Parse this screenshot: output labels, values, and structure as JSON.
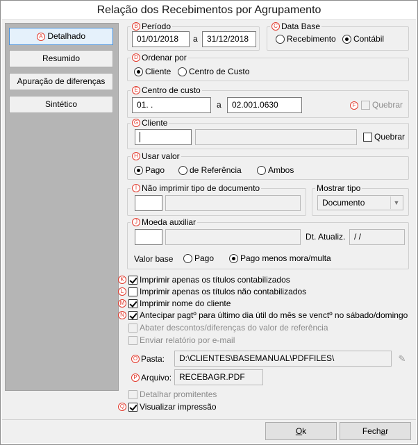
{
  "window": {
    "title": "Relação dos Recebimentos por Agrupamento"
  },
  "nav": {
    "items": [
      {
        "label": "Detalhado",
        "marker": "A"
      },
      {
        "label": "Resumido"
      },
      {
        "label": "Apuração de diferenças"
      },
      {
        "label": "Sintético"
      }
    ]
  },
  "periodo": {
    "legend": "Período",
    "marker": "B",
    "from": "01/01/2018",
    "sep": "a",
    "to": "31/12/2018"
  },
  "data_base": {
    "legend": "Data Base",
    "marker": "C",
    "opt1": "Recebimento",
    "opt2": "Contábil",
    "selected": "Contábil"
  },
  "ordenar": {
    "legend": "Ordenar por",
    "marker": "D",
    "opt1": "Cliente",
    "opt2": "Centro de Custo",
    "selected": "Cliente"
  },
  "centro": {
    "legend": "Centro de custo",
    "marker": "E",
    "from": "01.   .",
    "sep": "a",
    "to": "02.001.0630",
    "quebrar_marker": "F",
    "quebrar": "Quebrar"
  },
  "cliente": {
    "legend": "Cliente",
    "marker": "G",
    "code": "",
    "name": "",
    "quebrar": "Quebrar"
  },
  "usar_valor": {
    "legend": "Usar valor",
    "marker": "H",
    "opt1": "Pago",
    "opt2": "de Referência",
    "opt3": "Ambos",
    "selected": "Pago"
  },
  "nao_imprimir": {
    "legend": "Não imprimir tipo de documento",
    "marker": "I",
    "code": "",
    "desc": ""
  },
  "mostrar_tipo": {
    "legend": "Mostrar tipo",
    "value": "Documento"
  },
  "moeda": {
    "legend": "Moeda auxiliar",
    "marker": "J",
    "code": "",
    "desc": "",
    "dt_label": "Dt. Atualiz.",
    "dt_value": "/ /",
    "valor_base_label": "Valor base",
    "vb_opt1": "Pago",
    "vb_opt2": "Pago menos mora/multa",
    "vb_selected": "Pago menos mora/multa"
  },
  "checks": {
    "k": {
      "marker": "K",
      "label": "Imprimir apenas os títulos contabilizados",
      "checked": true
    },
    "l": {
      "marker": "L",
      "label": "Imprimir apenas os títulos não contabilizados",
      "checked": false
    },
    "m": {
      "marker": "M",
      "label": "Imprimir nome do cliente",
      "checked": true
    },
    "n": {
      "marker": "N",
      "label": "Antecipar pagtº para último dia útil do mês se venctº no sábado/domingo",
      "checked": true
    },
    "abater": {
      "label": "Abater descontos/diferenças do valor de referência",
      "checked": false
    },
    "email": {
      "label": "Enviar relatório por e-mail",
      "checked": false
    },
    "detalhar": {
      "label": "Detalhar promitentes",
      "checked": false
    },
    "q": {
      "marker": "Q",
      "label": "Visualizar impressão",
      "checked": true
    }
  },
  "pasta": {
    "marker": "O",
    "label": "Pasta:",
    "value": "D:\\CLIENTES\\BASEMANUAL\\PDFFILES\\"
  },
  "arquivo": {
    "marker": "P",
    "label": "Arquivo:",
    "value": "RECEBAGR.PDF"
  },
  "buttons": {
    "ok_u": "O",
    "ok_rest": "k",
    "fechar_pre": "Fech",
    "fechar_u": "a",
    "fechar_post": "r"
  }
}
